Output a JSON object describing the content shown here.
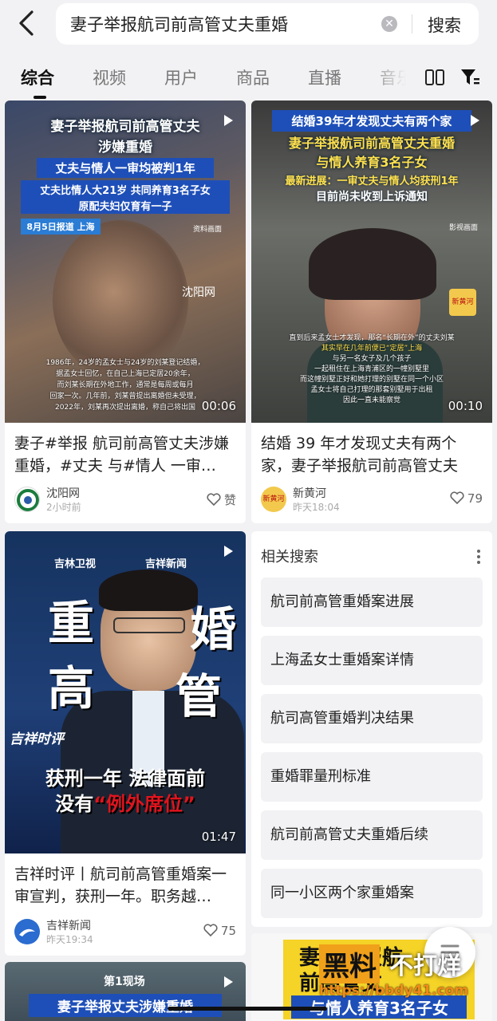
{
  "search": {
    "query": "妻子举报航司前高管丈夫重婚",
    "clear_icon": "clear-icon",
    "button_label": "搜索"
  },
  "tabs": [
    {
      "label": "综合",
      "active": true
    },
    {
      "label": "视频",
      "active": false
    },
    {
      "label": "用户",
      "active": false
    },
    {
      "label": "商品",
      "active": false
    },
    {
      "label": "直播",
      "active": false
    },
    {
      "label": "音乐",
      "active": false
    }
  ],
  "cards": [
    {
      "overlay_lines": [
        "妻子举报航司前高管丈夫",
        "涉嫌重婚",
        "丈夫与情人一审均被判1年",
        "丈夫比情人大21岁 共同养育3名子女",
        "原配夫妇仅育有一子"
      ],
      "report_tag": "8月5日报道 上海",
      "source_tag": "资料画面",
      "logo_text": "沈阳网",
      "caption_lines": [
        "1986年，24岁的孟女士与24岁的刘某登记结婚，",
        "据孟女士回忆，在自己上海已定居20余年，",
        "而刘某长期在外地工作，通常是每周或每月",
        "回家一次。几年前，刘某曾提出离婚但未受理，",
        "2022年，刘某再次提出离婚，称自己将出国"
      ],
      "duration": "00:06",
      "title": "妻子#举报 航司前高管丈夫涉嫌重婚，#丈夫 与#情人 一审…",
      "author": "沈阳网",
      "time": "2小时前",
      "likes": "赞"
    },
    {
      "overlay_lines": [
        "结婚39年才发现丈夫有两个家",
        "妻子举报航司前高管丈夫重婚",
        "与情人养育3名子女",
        "最新进展：一审丈夫与情人均获刑1年",
        "目前尚未收到上诉通知"
      ],
      "source_tag": "影视画面",
      "logo_text": "新黄河",
      "caption_lines": [
        "直到后来孟女士才发现，那名“长期在外”的丈夫刘某",
        "其实早在几年前便已“定居”上海",
        "与另一名女子及几个孩子",
        "一起租住在上海青浦区的一幢别墅里",
        "而这幢别墅正好和她打理的别墅在同一个小区",
        "孟女士将自己打理的那套别墅用于出租",
        "因此一直未能察觉"
      ],
      "duration": "00:10",
      "title": "结婚 39 年才发现丈夫有两个家，妻子举报航司前高管丈夫重…",
      "author": "新黄河",
      "time": "昨天18:04",
      "likes": "79"
    },
    {
      "brand_left": "吉林卫视",
      "brand_right": "吉祥新闻",
      "big_chars": [
        "重",
        "婚",
        "高",
        "管"
      ],
      "program": "吉祥时评",
      "headline1": "获刑一年 法律面前",
      "headline2a": "没有",
      "headline2b": "“例外席位”",
      "duration": "01:47",
      "title": "吉祥时评丨航司前高管重婚案一审宣判，获刑一年。职务越…",
      "author": "吉祥新闻",
      "time": "昨天19:34",
      "likes": "75"
    },
    {
      "badge": "第1现场",
      "line": "妻子举报丈夫涉嫌重婚"
    }
  ],
  "related": {
    "title": "相关搜索",
    "items": [
      "航司前高管重婚案进展",
      "上海孟女士重婚案详情",
      "航司高管重婚判决结果",
      "重婚罪量刑标准",
      "航司前高管丈夫重婚后续",
      "同一小区两个家重婚案"
    ]
  },
  "bottom_preview": {
    "lines": [
      "妻子举报航",
      "前高管丈",
      "与情人养育3名子女"
    ]
  },
  "watermark": {
    "brand_a": "黑料",
    "brand_b": "不打烊",
    "url": "https://bbdy41.com"
  },
  "colors": {
    "background": "#f2f2f4",
    "overlay_blue": "#1e4fb8",
    "overlay_yellow": "#ffe14d",
    "accent_red": "#e0141e"
  }
}
